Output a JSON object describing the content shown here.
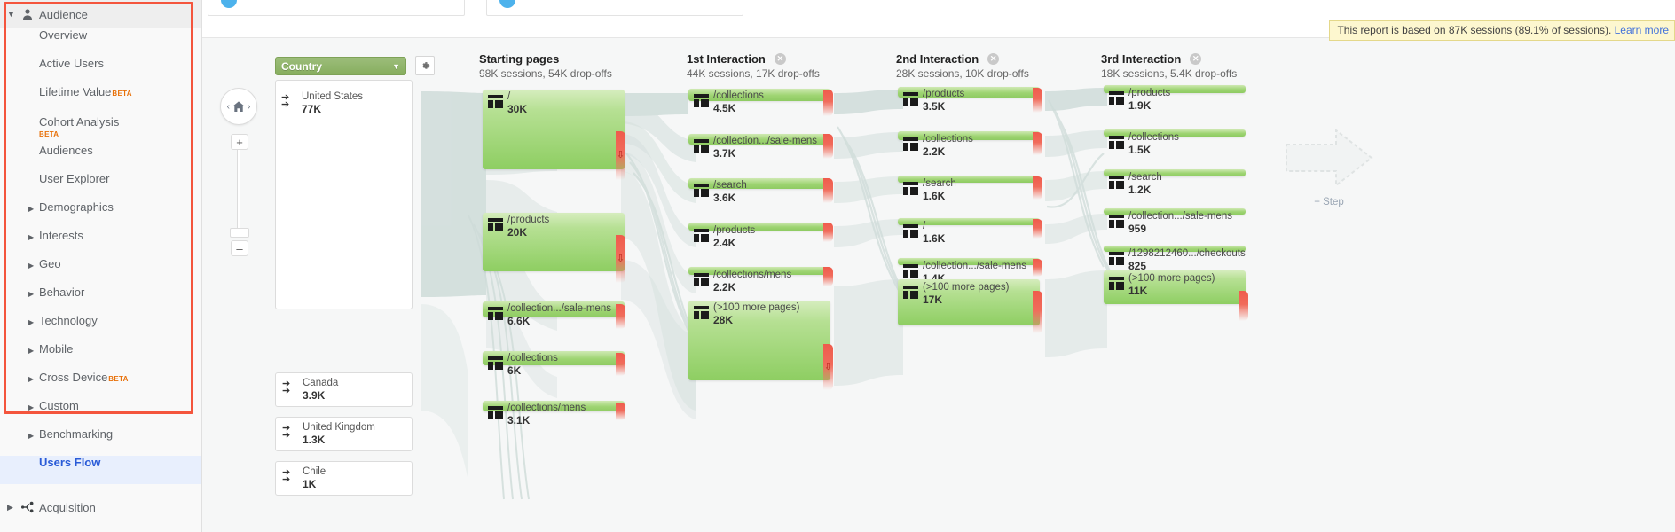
{
  "sidebar": {
    "sections": [
      {
        "label": "Audience",
        "icon": "person-icon",
        "expanded": true
      },
      {
        "label": "Acquisition",
        "icon": "acquisition-icon",
        "expanded": false
      }
    ],
    "items": [
      {
        "label": "Overview",
        "type": "leaf"
      },
      {
        "label": "Active Users",
        "type": "leaf"
      },
      {
        "label": "Lifetime Value",
        "type": "leaf",
        "badge": "BETA",
        "badge_pos": "inline"
      },
      {
        "label": "Cohort Analysis",
        "type": "leaf",
        "badge": "BETA",
        "badge_pos": "below"
      },
      {
        "label": "Audiences",
        "type": "leaf"
      },
      {
        "label": "User Explorer",
        "type": "leaf"
      },
      {
        "label": "Demographics",
        "type": "group"
      },
      {
        "label": "Interests",
        "type": "group"
      },
      {
        "label": "Geo",
        "type": "group"
      },
      {
        "label": "Behavior",
        "type": "group"
      },
      {
        "label": "Technology",
        "type": "group"
      },
      {
        "label": "Mobile",
        "type": "group"
      },
      {
        "label": "Cross Device",
        "type": "group",
        "badge": "BETA",
        "badge_pos": "inline"
      },
      {
        "label": "Custom",
        "type": "group"
      },
      {
        "label": "Benchmarking",
        "type": "group"
      },
      {
        "label": "Users Flow",
        "type": "leaf",
        "active": true
      }
    ],
    "highlight_color": "#f4553d",
    "active_color": "#2a5bd7"
  },
  "banner": {
    "text": "This report is based on 87K sessions (89.1% of sessions). ",
    "link": "Learn more"
  },
  "controls": {
    "dimension_label": "Country",
    "dimension_caret": "▼",
    "gear_icon": "gear-icon",
    "home_icon": "home-icon",
    "prev_icon": "‹",
    "next_icon": "›",
    "zoom_in": "+",
    "zoom_out": "–"
  },
  "add_step": {
    "label": "+ Step",
    "icon": "right-arrow-outline-icon"
  },
  "chart_data": {
    "type": "sankey",
    "title": "Users Flow",
    "columns": [
      {
        "title": "Starting pages",
        "subtitle": "98K sessions, 54K drop-offs",
        "closable": false
      },
      {
        "title": "1st Interaction",
        "subtitle": "44K sessions, 17K drop-offs",
        "closable": true
      },
      {
        "title": "2nd Interaction",
        "subtitle": "28K sessions, 10K drop-offs",
        "closable": true
      },
      {
        "title": "3rd Interaction",
        "subtitle": "18K sessions, 5.4K drop-offs",
        "closable": true
      }
    ],
    "dimension_nodes": [
      {
        "name": "United States",
        "value": "77K"
      },
      {
        "name": "Canada",
        "value": "3.9K"
      },
      {
        "name": "United Kingdom",
        "value": "1.3K"
      },
      {
        "name": "Chile",
        "value": "1K"
      }
    ],
    "nodes": {
      "starting_pages": [
        {
          "name": "/",
          "value": "30K"
        },
        {
          "name": "/products",
          "value": "20K"
        },
        {
          "name": "/collection.../sale-mens",
          "value": "6.6K"
        },
        {
          "name": "/collections",
          "value": "6K"
        },
        {
          "name": "/collections/mens",
          "value": "3.1K"
        }
      ],
      "interaction_1": [
        {
          "name": "/collections",
          "value": "4.5K"
        },
        {
          "name": "/collection.../sale-mens",
          "value": "3.7K"
        },
        {
          "name": "/search",
          "value": "3.6K"
        },
        {
          "name": "/products",
          "value": "2.4K"
        },
        {
          "name": "/collections/mens",
          "value": "2.2K"
        },
        {
          "name": "(>100 more pages)",
          "value": "28K"
        }
      ],
      "interaction_2": [
        {
          "name": "/products",
          "value": "3.5K"
        },
        {
          "name": "/collections",
          "value": "2.2K"
        },
        {
          "name": "/search",
          "value": "1.6K"
        },
        {
          "name": "/",
          "value": "1.6K"
        },
        {
          "name": "/collection.../sale-mens",
          "value": "1.4K"
        },
        {
          "name": "(>100 more pages)",
          "value": "17K"
        }
      ],
      "interaction_3": [
        {
          "name": "/products",
          "value": "1.9K"
        },
        {
          "name": "/collections",
          "value": "1.5K"
        },
        {
          "name": "/search",
          "value": "1.2K"
        },
        {
          "name": "/collection.../sale-mens",
          "value": "959"
        },
        {
          "name": "/1298212460.../checkouts",
          "value": "825"
        },
        {
          "name": "(>100 more pages)",
          "value": "11K"
        }
      ]
    }
  },
  "colors": {
    "node_green_top": "#d6edbe",
    "node_green_bottom": "#8ece62",
    "dropoff_red": "#ef5b4c",
    "flow_gray": "#cfdcd9",
    "banner_bg": "#fdf7cf",
    "dimension_green": "#8fb567"
  }
}
